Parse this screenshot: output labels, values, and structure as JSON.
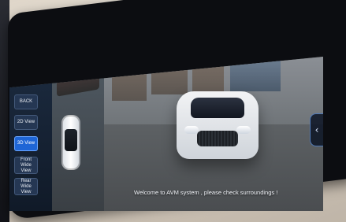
{
  "sidebar": {
    "buttons": [
      {
        "id": "back",
        "label": "BACK"
      },
      {
        "id": "view_2d",
        "label": "2D View"
      },
      {
        "id": "view_3d",
        "label": "3D View",
        "active": true
      },
      {
        "id": "front_wide",
        "label": "Front\nWide View"
      },
      {
        "id": "rear_wide",
        "label": "Rear\nWide View"
      }
    ]
  },
  "main": {
    "message": "Welcome to AVM system , please check surroundings !"
  },
  "icons": {
    "collapse": "chevron-left-icon"
  },
  "colors": {
    "active_button": "#1f66d6",
    "sidebar": "#1c2b40"
  }
}
